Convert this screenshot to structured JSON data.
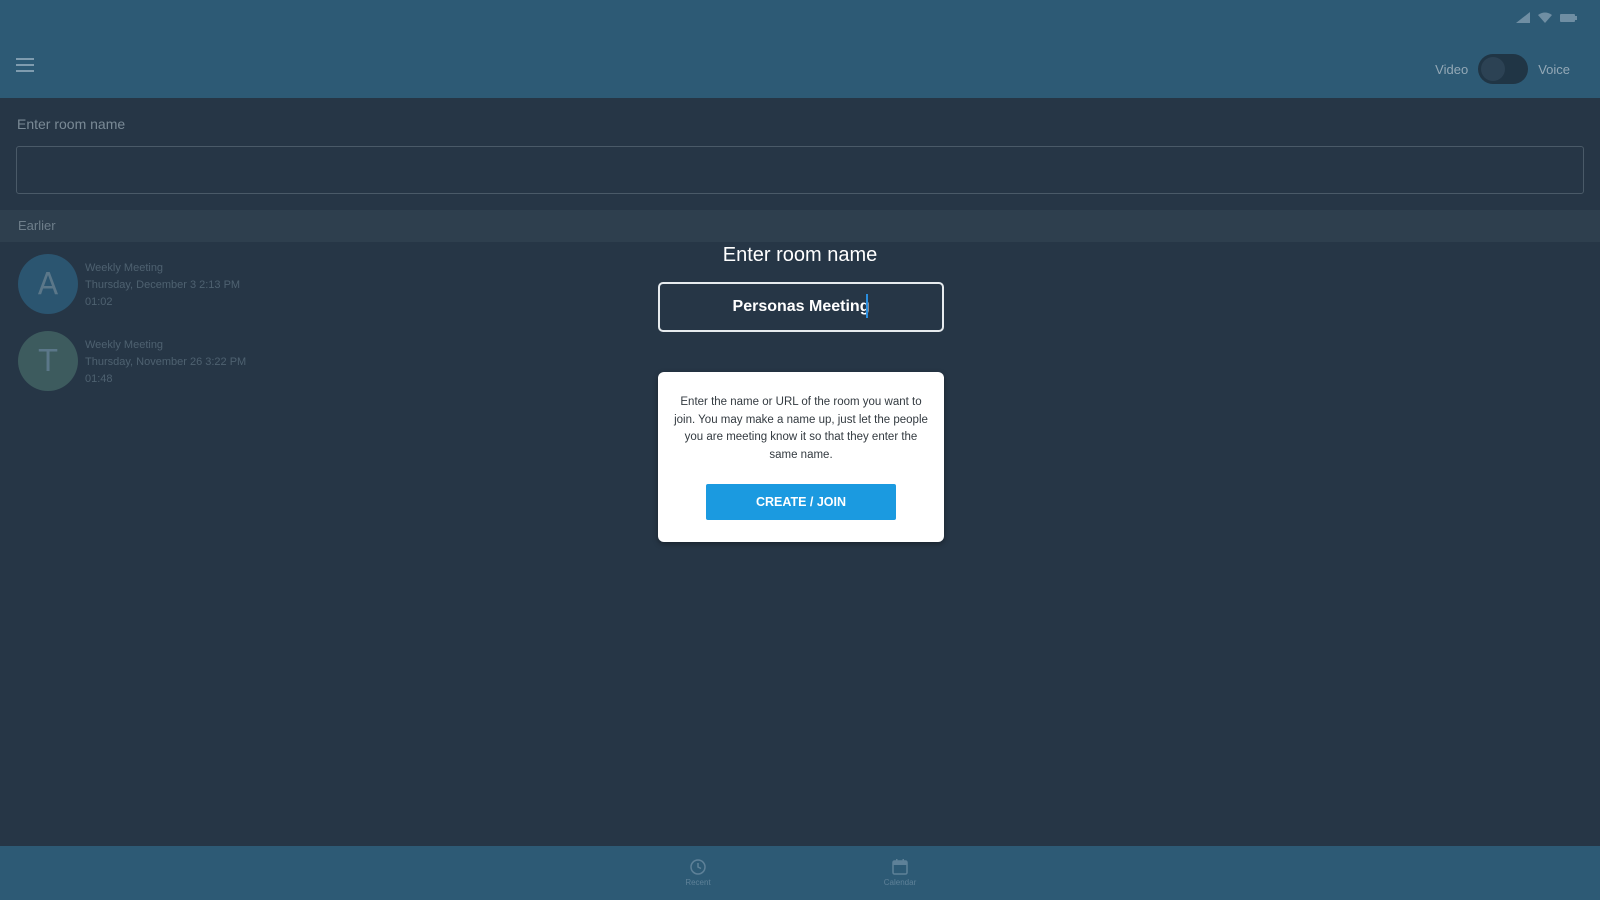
{
  "header": {
    "mode_left_label": "Video",
    "mode_right_label": "Voice"
  },
  "room_field": {
    "label": "Enter room name",
    "value": ""
  },
  "history": {
    "section_label": "Earlier",
    "items": [
      {
        "avatar_letter": "A",
        "title": "Weekly Meeting",
        "date": "Thursday, December 3 2:13 PM",
        "duration": "01:02"
      },
      {
        "avatar_letter": "T",
        "title": "Weekly Meeting",
        "date": "Thursday, November 26 3:22 PM",
        "duration": "01:48"
      }
    ]
  },
  "overlay": {
    "title": "Enter room name",
    "room_value": "Personas Meeting",
    "hint": "Enter the name or URL of the room you want to join. You may make a name up, just let the people you are meeting know it so that they enter the same name.",
    "join_label": "CREATE / JOIN"
  },
  "bottom_nav": {
    "items": [
      {
        "label": "Recent",
        "icon": "clock-icon"
      },
      {
        "label": "Calendar",
        "icon": "calendar-icon"
      }
    ]
  },
  "colors": {
    "app_bar": "#2d5a75",
    "background": "#263646",
    "accent": "#1b9ae0"
  }
}
